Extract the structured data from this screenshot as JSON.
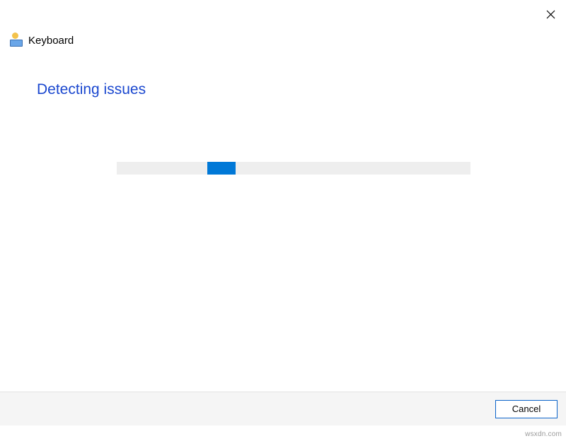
{
  "window": {
    "title": "Keyboard"
  },
  "main": {
    "heading": "Detecting issues"
  },
  "progress": {
    "indicator_left_percent": 25.6,
    "indicator_width_percent": 8.0
  },
  "footer": {
    "cancel_label": "Cancel"
  },
  "watermark": "wsxdn.com"
}
